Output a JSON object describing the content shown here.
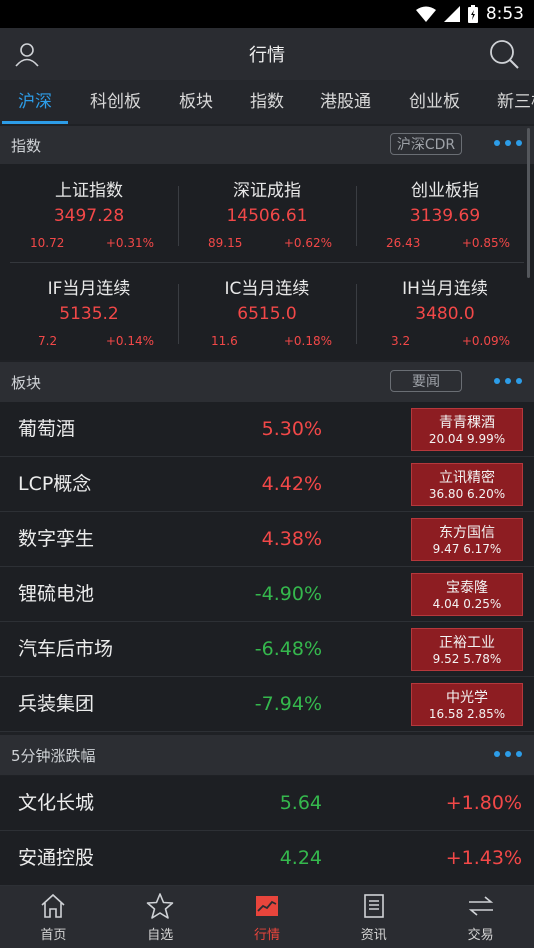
{
  "status": {
    "time": "8:53"
  },
  "header": {
    "title": "行情"
  },
  "tabs": [
    "沪深",
    "科创板",
    "板块",
    "指数",
    "港股通",
    "创业板",
    "新三板"
  ],
  "index_section": {
    "title": "指数",
    "pill": "沪深CDR"
  },
  "indices": [
    {
      "name": "上证指数",
      "price": "3497.28",
      "chg": "10.72",
      "pct": "+0.31%"
    },
    {
      "name": "深证成指",
      "price": "14506.61",
      "chg": "89.15",
      "pct": "+0.62%"
    },
    {
      "name": "创业板指",
      "price": "3139.69",
      "chg": "26.43",
      "pct": "+0.85%"
    },
    {
      "name": "IF当月连续",
      "price": "5135.2",
      "chg": "7.2",
      "pct": "+0.14%"
    },
    {
      "name": "IC当月连续",
      "price": "6515.0",
      "chg": "11.6",
      "pct": "+0.18%"
    },
    {
      "name": "IH当月连续",
      "price": "3480.0",
      "chg": "3.2",
      "pct": "+0.09%"
    }
  ],
  "sector_section": {
    "title": "板块",
    "pill": "要闻"
  },
  "sectors": [
    {
      "name": "葡萄酒",
      "value": "5.30%",
      "dir": "up",
      "stock": "青青稞酒",
      "stock_info": "20.04 9.99%"
    },
    {
      "name": "LCP概念",
      "value": "4.42%",
      "dir": "up",
      "stock": "立讯精密",
      "stock_info": "36.80 6.20%"
    },
    {
      "name": "数字孪生",
      "value": "4.38%",
      "dir": "up",
      "stock": "东方国信",
      "stock_info": "9.47 6.17%"
    },
    {
      "name": "锂硫电池",
      "value": "-4.90%",
      "dir": "down",
      "stock": "宝泰隆",
      "stock_info": "4.04 0.25%"
    },
    {
      "name": "汽车后市场",
      "value": "-6.48%",
      "dir": "down",
      "stock": "正裕工业",
      "stock_info": "9.52 5.78%"
    },
    {
      "name": "兵装集团",
      "value": "-7.94%",
      "dir": "down",
      "stock": "中光学",
      "stock_info": "16.58 2.85%"
    }
  ],
  "movers_section": {
    "title": "5分钟涨跌幅"
  },
  "movers": [
    {
      "name": "文化长城",
      "price": "5.64",
      "pct": "+1.80%"
    },
    {
      "name": "安通控股",
      "price": "4.24",
      "pct": "+1.43%"
    }
  ],
  "nav": [
    {
      "label": "首页",
      "icon": "home-icon"
    },
    {
      "label": "自选",
      "icon": "star-icon"
    },
    {
      "label": "行情",
      "icon": "chart-icon"
    },
    {
      "label": "资讯",
      "icon": "news-icon"
    },
    {
      "label": "交易",
      "icon": "trade-icon"
    }
  ],
  "colors": {
    "accent": "#2d9de8",
    "up": "#f24848",
    "down": "#35b84d",
    "badge": "#8d1d22",
    "nav_active": "#e8453c"
  }
}
